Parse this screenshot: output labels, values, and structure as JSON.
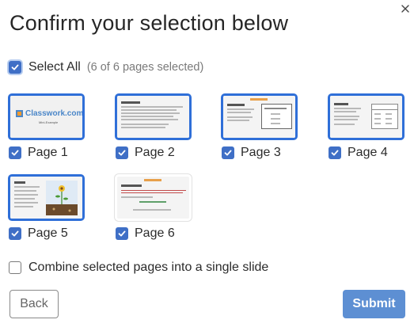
{
  "dialog": {
    "title": "Confirm your selection below"
  },
  "select_all": {
    "label": "Select All",
    "count_text": "(6 of 6 pages selected)",
    "checked": true
  },
  "pages": [
    {
      "label": "Page 1",
      "checked": true,
      "thumb_text": "Classwork.com",
      "thumb_subtext": "Mini-Example"
    },
    {
      "label": "Page 2",
      "checked": true
    },
    {
      "label": "Page 3",
      "checked": true
    },
    {
      "label": "Page 4",
      "checked": true
    },
    {
      "label": "Page 5",
      "checked": true
    },
    {
      "label": "Page 6",
      "checked": true
    }
  ],
  "combine": {
    "label": "Combine selected pages into a single slide",
    "checked": false
  },
  "buttons": {
    "back": "Back",
    "submit": "Submit"
  },
  "colors": {
    "accent": "#3f6fc6",
    "thumb_border": "#2f6fd8",
    "submit_bg": "#5d8fd3"
  }
}
